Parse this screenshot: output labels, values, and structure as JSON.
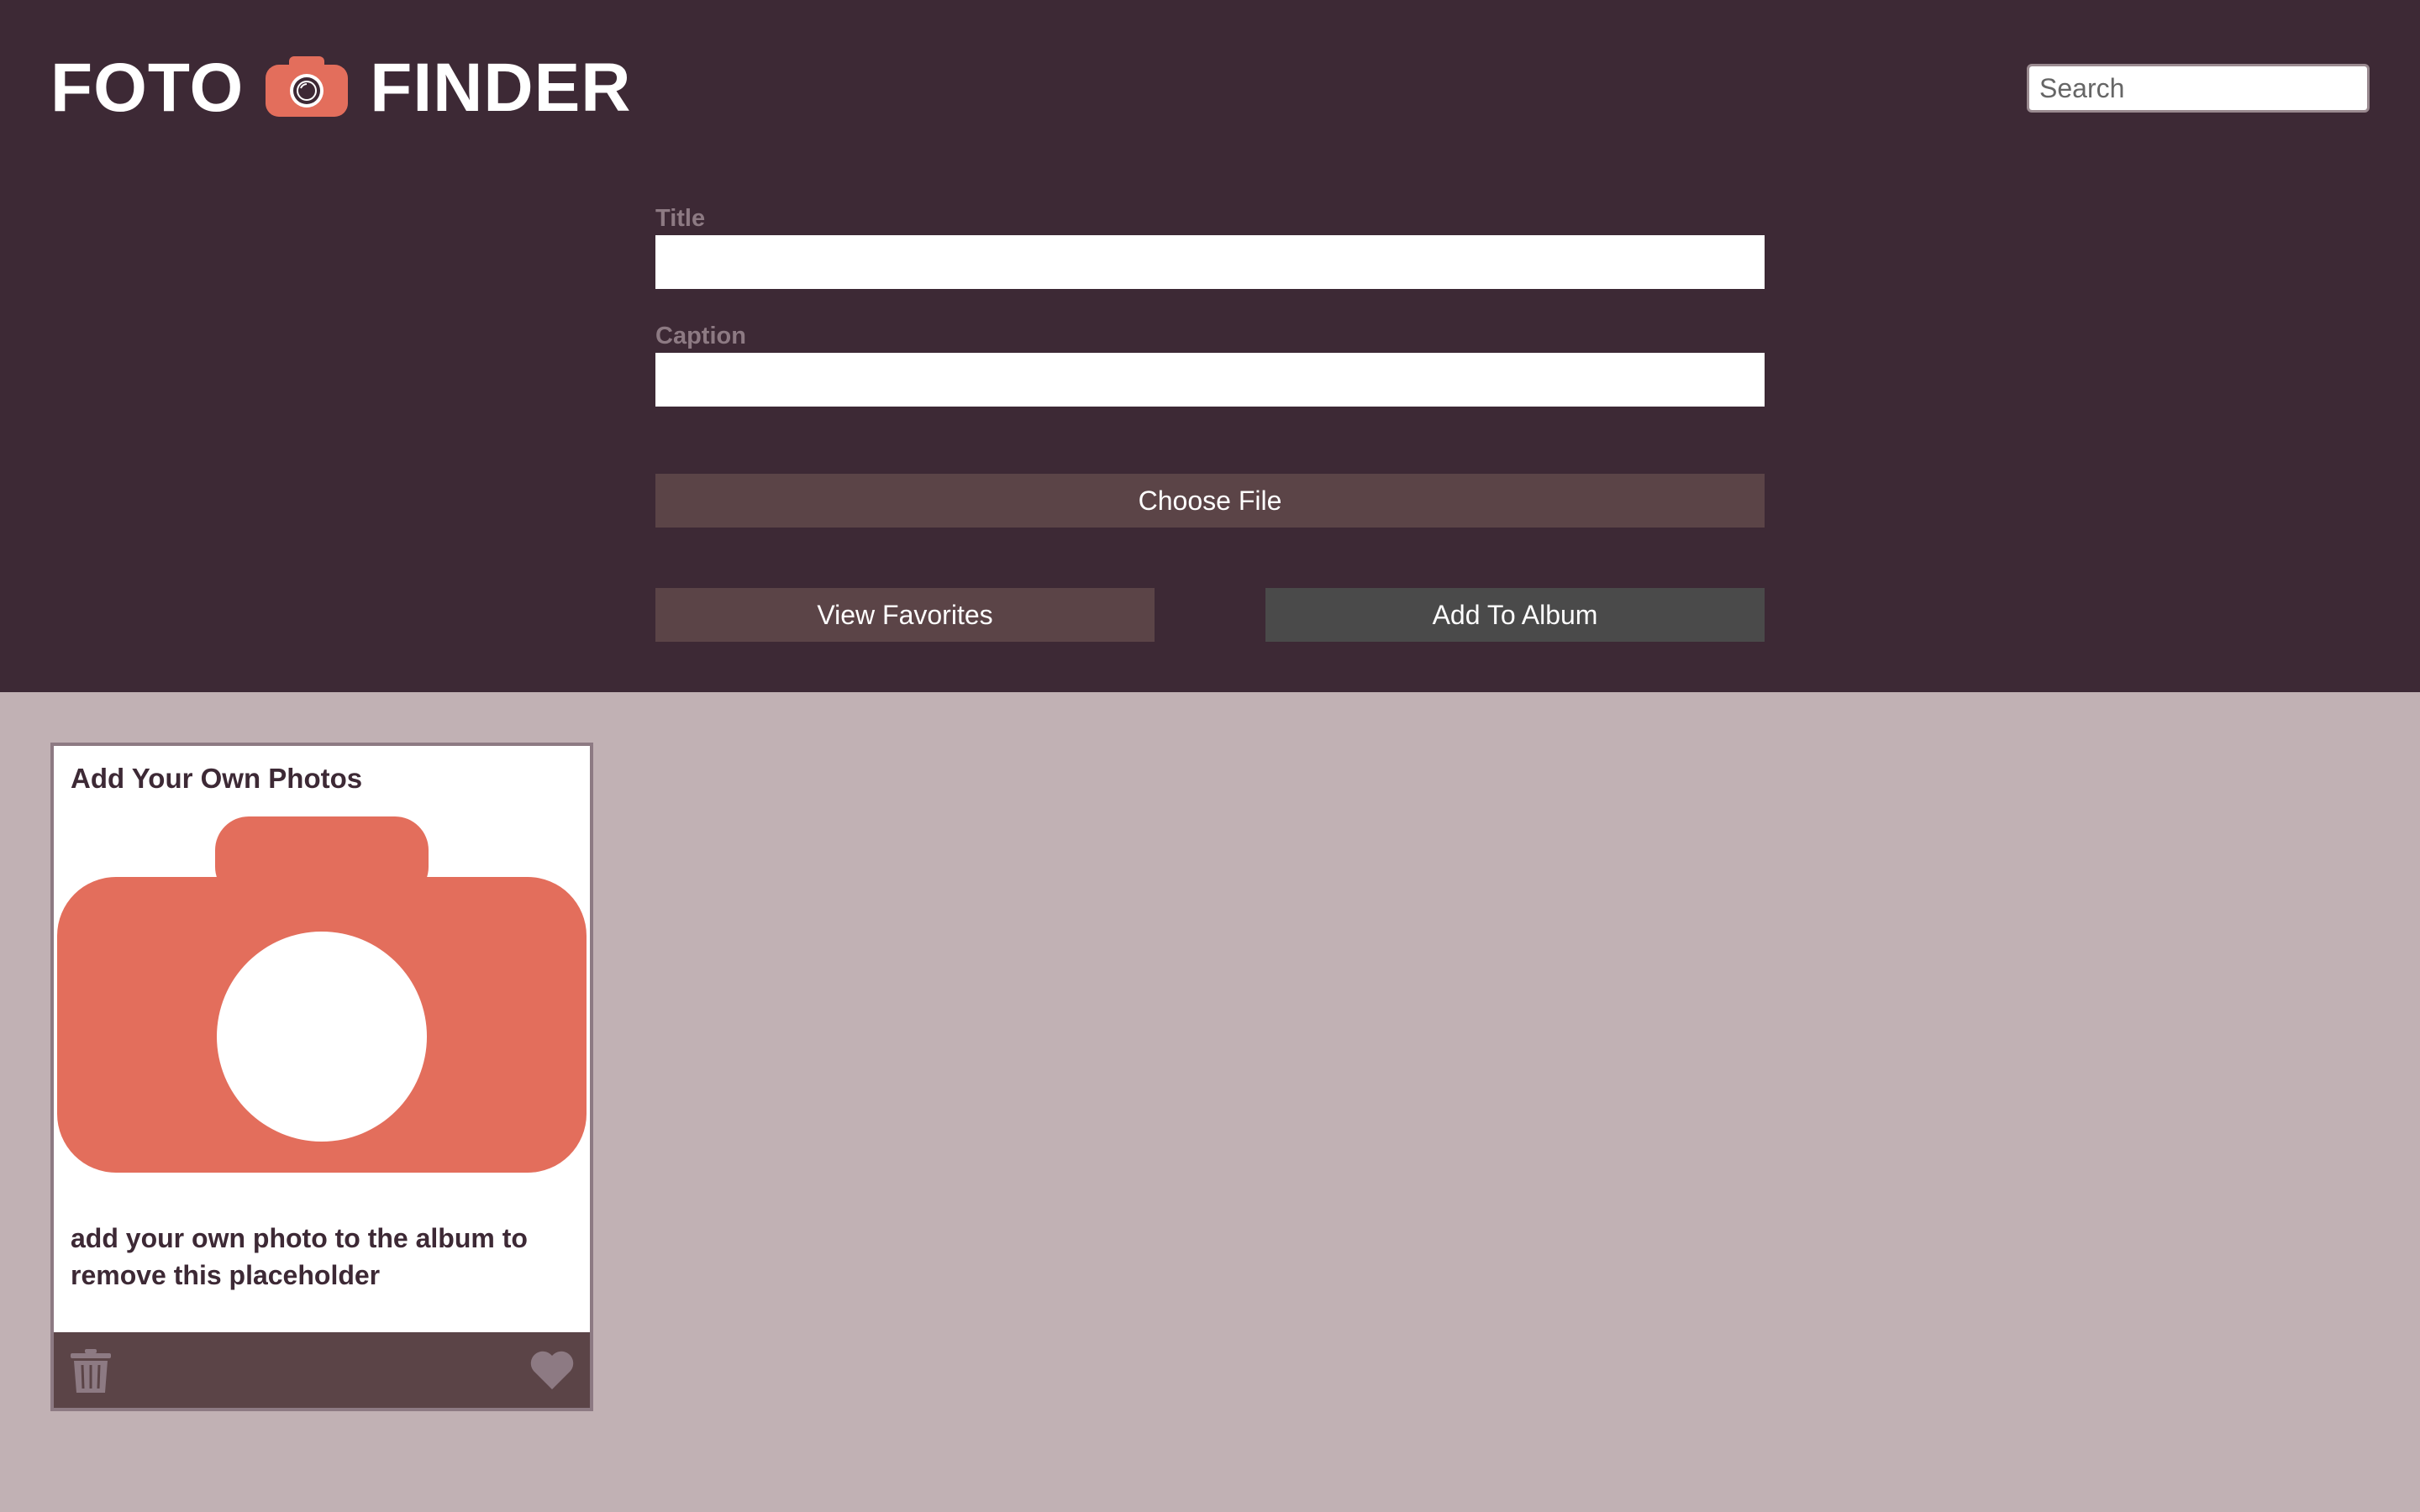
{
  "app": {
    "title_left": "FOTO",
    "title_right": "FINDER",
    "logo_icon": "camera-icon"
  },
  "search": {
    "placeholder": "Search",
    "icon": "search-icon"
  },
  "form": {
    "title_label": "Title",
    "title_value": "",
    "caption_label": "Caption",
    "caption_value": "",
    "choose_file_label": "Choose File",
    "view_favorites_label": "View Favorites",
    "add_to_album_label": "Add To Album"
  },
  "cards": [
    {
      "title": "Add Your Own Photos",
      "caption": "add your own photo to the album to remove this placeholder",
      "image_icon": "camera-icon",
      "delete_icon": "trash-icon",
      "favorite_icon": "heart-icon"
    }
  ],
  "colors": {
    "header_bg": "#3d2935",
    "page_bg": "#c1b1b4",
    "accent": "#e36e5c",
    "button_dark": "#5b4447",
    "button_grey": "#4a4a4a"
  }
}
